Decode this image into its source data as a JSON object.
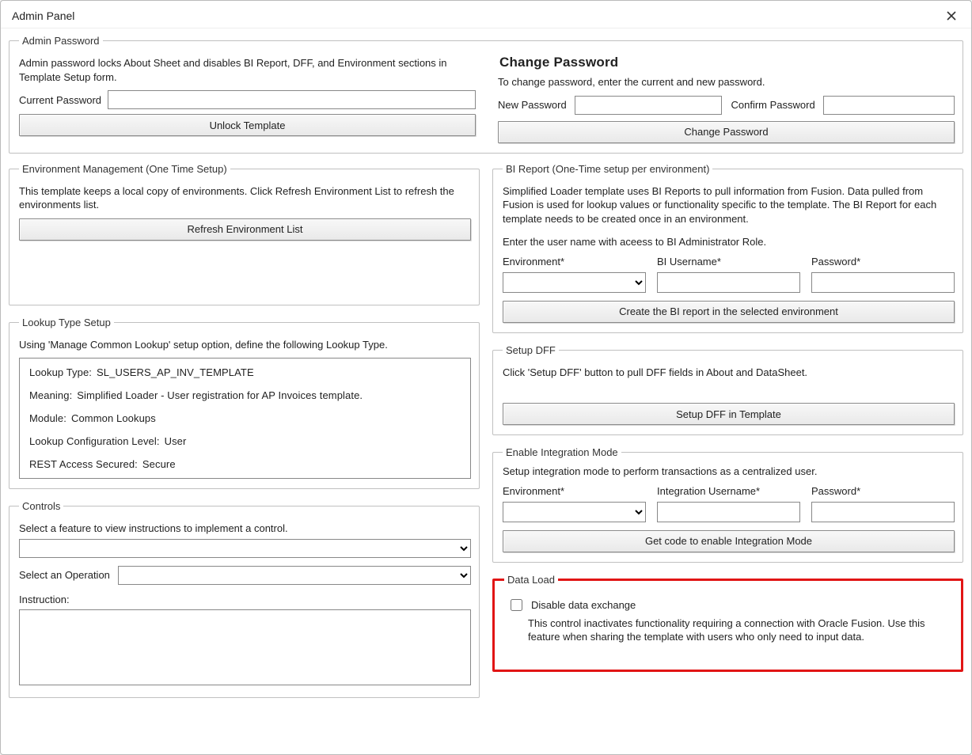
{
  "window": {
    "title": "Admin Panel"
  },
  "admin_password": {
    "legend": "Admin Password",
    "desc": "Admin password locks About Sheet and disables BI Report, DFF, and Environment sections in Template Setup form.",
    "current_password_label": "Current Password",
    "current_password_value": "",
    "unlock_btn": "Unlock Template"
  },
  "change_password": {
    "title": "Change Password",
    "desc": "To change password, enter the current and new password.",
    "new_password_label": "New Password",
    "new_password_value": "",
    "confirm_password_label": "Confirm Password",
    "confirm_password_value": "",
    "change_btn": "Change Password"
  },
  "env_mgmt": {
    "legend": "Environment Management (One Time Setup)",
    "desc": "This template keeps a local copy of environments. Click Refresh Environment List to refresh the environments list.",
    "refresh_btn": "Refresh Environment List"
  },
  "lookup": {
    "legend": "Lookup Type Setup",
    "desc": "Using 'Manage Common Lookup' setup option, define the following Lookup Type.",
    "lines": {
      "lookup_type_k": "Lookup Type:",
      "lookup_type_v": "SL_USERS_AP_INV_TEMPLATE",
      "meaning_k": "Meaning:",
      "meaning_v": "Simplified Loader - User registration for AP Invoices template.",
      "module_k": "Module:",
      "module_v": "Common Lookups",
      "config_k": "Lookup Configuration Level:",
      "config_v": "User",
      "rest_k": "REST Access Secured:",
      "rest_v": "Secure"
    }
  },
  "controls": {
    "legend": "Controls",
    "select_feature_label": "Select a feature to view instructions to implement a control.",
    "feature_value": "",
    "select_op_label": "Select an Operation",
    "op_value": "",
    "instruction_label": "Instruction:",
    "instruction_value": ""
  },
  "bi_report": {
    "legend": "BI Report (One-Time setup per environment)",
    "desc": "Simplified Loader template uses BI Reports to pull information from Fusion. Data pulled from Fusion is used for lookup values or functionality specific to the template. The BI Report for each template needs to be created once in an environment.",
    "desc2": "Enter the user name with aceess to BI Administrator Role.",
    "env_label": "Environment*",
    "env_value": "",
    "user_label": "BI Username*",
    "user_value": "",
    "pw_label": "Password*",
    "pw_value": "",
    "create_btn": "Create the BI report in the selected environment"
  },
  "setup_dff": {
    "legend": "Setup DFF",
    "desc": "Click 'Setup DFF' button to pull DFF fields in About and DataSheet.",
    "btn": "Setup DFF in Template"
  },
  "integration": {
    "legend": "Enable Integration Mode",
    "desc": "Setup integration mode to perform transactions as a centralized user.",
    "env_label": "Environment*",
    "env_value": "",
    "user_label": "Integration Username*",
    "user_value": "",
    "pw_label": "Password*",
    "pw_value": "",
    "btn": "Get code to enable Integration Mode"
  },
  "data_load": {
    "legend": "Data Load",
    "checkbox_label": "Disable data exchange",
    "checked": false,
    "desc": "This control inactivates functionality requiring a connection with Oracle Fusion. Use this feature when sharing the template with users who only need to input data."
  }
}
